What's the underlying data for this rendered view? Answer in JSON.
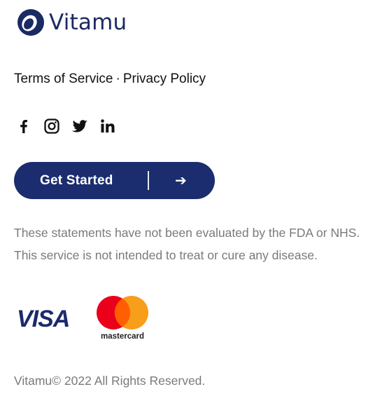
{
  "brand": {
    "name": "Vitamu",
    "color": "#1b2a63"
  },
  "legal": {
    "terms_label": "Terms of Service",
    "separator": "·",
    "privacy_label": "Privacy Policy"
  },
  "social": [
    {
      "icon": "facebook-icon"
    },
    {
      "icon": "instagram-icon"
    },
    {
      "icon": "twitter-icon"
    },
    {
      "icon": "linkedin-icon"
    }
  ],
  "cta": {
    "label": "Get Started",
    "arrow": "➔",
    "color": "#1b2d6e"
  },
  "disclaimer": "These statements have not been evaluated by the FDA or NHS. This service is not intended to treat or cure any disease.",
  "payments": {
    "visa_label": "VISA",
    "mastercard_label": "mastercard"
  },
  "copyright": "Vitamu© 2022 All Rights Reserved."
}
